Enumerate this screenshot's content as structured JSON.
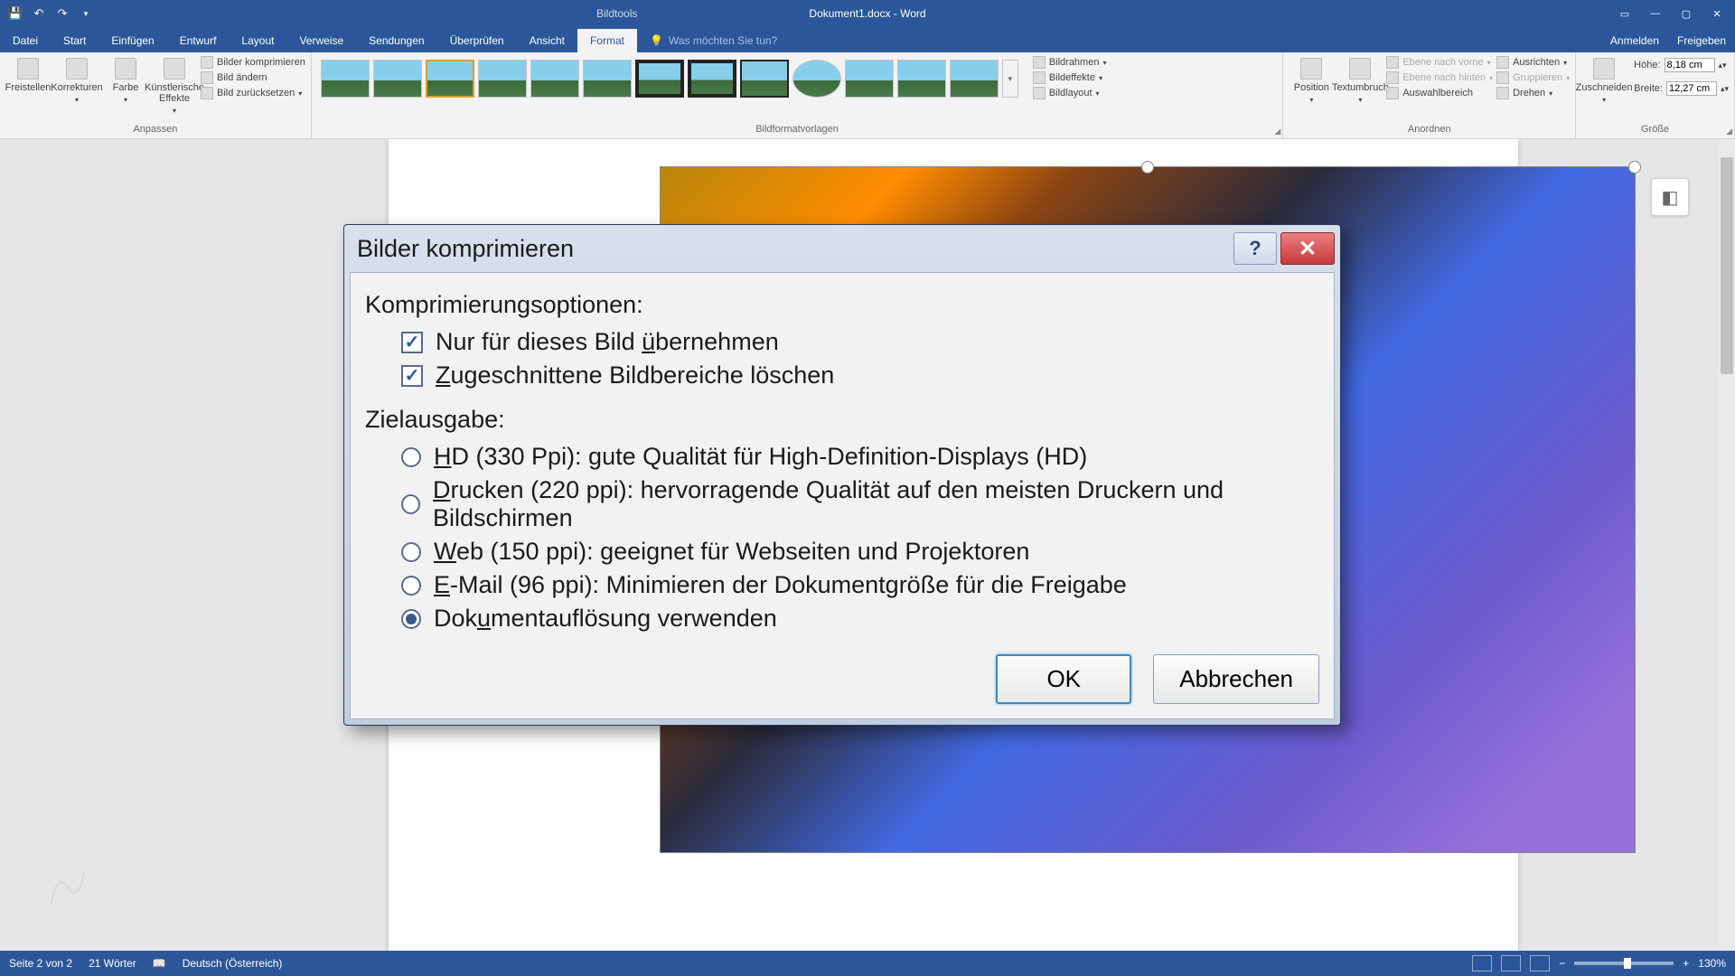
{
  "titlebar": {
    "context_tab": "Bildtools",
    "document_title": "Dokument1.docx - Word"
  },
  "qat": {
    "save": "Speichern",
    "undo": "Rückgängig",
    "redo": "Wiederholen"
  },
  "window": {
    "ribbon_display": "Menüband-Anzeigeoptionen",
    "minimize": "Minimieren",
    "restore": "Wiederherstellen",
    "close": "Schließen"
  },
  "tabs": {
    "datei": "Datei",
    "start": "Start",
    "einfuegen": "Einfügen",
    "entwurf": "Entwurf",
    "layout": "Layout",
    "verweise": "Verweise",
    "sendungen": "Sendungen",
    "ueberpruefen": "Überprüfen",
    "ansicht": "Ansicht",
    "format": "Format",
    "tellme_placeholder": "Was möchten Sie tun?",
    "anmelden": "Anmelden",
    "freigeben": "Freigeben"
  },
  "ribbon": {
    "anpassen": {
      "label": "Anpassen",
      "freistellen": "Freistellen",
      "korrekturen": "Korrekturen",
      "farbe": "Farbe",
      "kuenstlerische": "Künstlerische Effekte",
      "komprimieren": "Bilder komprimieren",
      "aendern": "Bild ändern",
      "zuruecksetzen": "Bild zurücksetzen"
    },
    "bildformatvorlagen": {
      "label": "Bildformatvorlagen",
      "bildrahmen": "Bildrahmen",
      "bildeffekte": "Bildeffekte",
      "bildlayout": "Bildlayout"
    },
    "anordnen": {
      "label": "Anordnen",
      "position": "Position",
      "textumbruch": "Textumbruch",
      "nachvorne": "Ebene nach vorne",
      "nachhinten": "Ebene nach hinten",
      "auswahlbereich": "Auswahlbereich",
      "ausrichten": "Ausrichten",
      "gruppieren": "Gruppieren",
      "drehen": "Drehen"
    },
    "groesse": {
      "label": "Größe",
      "zuschneiden": "Zuschneiden",
      "hoehe": "Höhe:",
      "hoehe_val": "8,18 cm",
      "breite": "Breite:",
      "breite_val": "12,27 cm"
    }
  },
  "dialog": {
    "title": "Bilder komprimieren",
    "section_options": "Komprimierungsoptionen:",
    "opt1_pre": "Nur für dieses Bild ",
    "opt1_ul": "ü",
    "opt1_post": "bernehmen",
    "opt2_ul": "Z",
    "opt2_post": "ugeschnittene Bildbereiche löschen",
    "section_target": "Zielausgabe:",
    "r1_ul": "H",
    "r1_post": "D (330 Ppi): gute Qualität für High-Definition-Displays (HD)",
    "r2_ul": "D",
    "r2_post": "rucken (220 ppi): hervorragende Qualität auf den meisten Druckern und Bildschirmen",
    "r3_ul": "W",
    "r3_post": "eb (150 ppi): geeignet für Webseiten und Projektoren",
    "r4_ul": "E",
    "r4_post": "-Mail (96 ppi): Minimieren der Dokumentgröße für die Freigabe",
    "r5_pre": "Dok",
    "r5_ul": "u",
    "r5_post": "mentauflösung verwenden",
    "ok": "OK",
    "cancel": "Abbrechen",
    "help": "?",
    "close": "✕"
  },
  "statusbar": {
    "page": "Seite 2 von 2",
    "words": "21 Wörter",
    "language": "Deutsch (Österreich)",
    "zoom_minus": "−",
    "zoom_plus": "+",
    "zoom": "130%"
  }
}
